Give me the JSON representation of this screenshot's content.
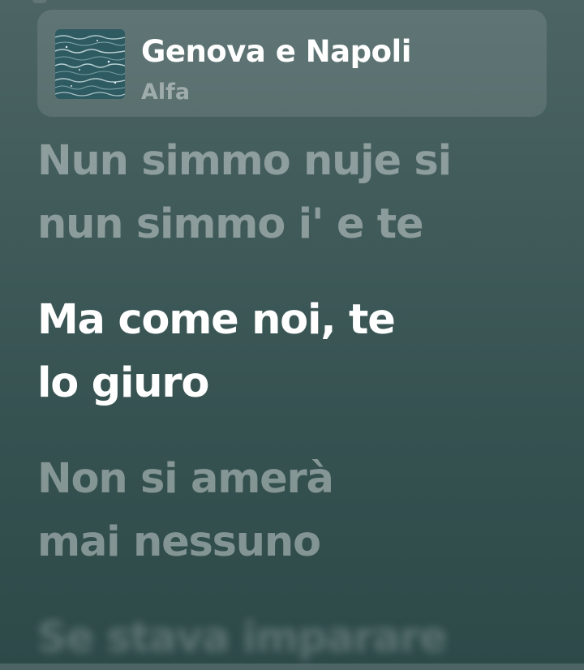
{
  "now_playing": {
    "title": "Genova e Napoli",
    "artist": "Alfa",
    "artwork_icon": "sea-water-artwork"
  },
  "lyrics": [
    {
      "state": "past",
      "lines": [
        "Nun simmo nuje si",
        "nun simmo i' e te"
      ]
    },
    {
      "state": "active",
      "lines": [
        "Ma come noi, te",
        "lo giuro"
      ]
    },
    {
      "state": "next",
      "lines": [
        "Non si amerà",
        "mai nessuno"
      ]
    },
    {
      "state": "upcoming-blurred",
      "lines": [
        "Se stava imparare"
      ]
    }
  ],
  "colors": {
    "background_top": "#4d6464",
    "background_bottom": "#2d4a49",
    "active_lyric": "#ffffff"
  }
}
